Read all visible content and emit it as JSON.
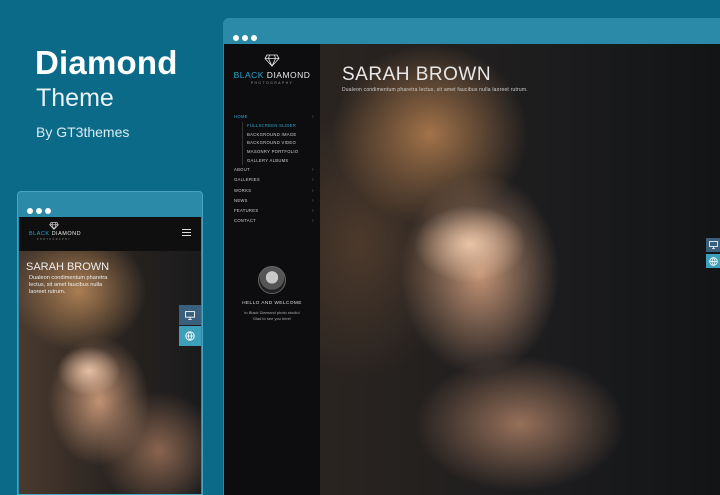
{
  "promo": {
    "title": "Diamond",
    "subtitle": "Theme",
    "byline": "By GT3themes"
  },
  "brand": {
    "logo_black": "BLACK",
    "logo_diamond": " DIAMOND",
    "logo_sub": "PHOTOGRAPHY"
  },
  "sidebar": {
    "menu": [
      {
        "label": "HOME",
        "active": true
      },
      {
        "label": "ABOUT"
      },
      {
        "label": "GALLERIES"
      },
      {
        "label": "WORKS"
      },
      {
        "label": "NEWS"
      },
      {
        "label": "FEATURES"
      },
      {
        "label": "CONTACT"
      }
    ],
    "submenu": [
      {
        "label": "FULLSCREEN SLIDER",
        "active": true
      },
      {
        "label": "BACKGROUND IMAGE"
      },
      {
        "label": "BACKGROUND VIDEO"
      },
      {
        "label": "MASONRY PORTFOLIO"
      },
      {
        "label": "GALLERY ALBUMS"
      }
    ],
    "welcome_title": "HELLO AND WELCOME",
    "welcome_line1": "to Black Diamond photo studio!",
    "welcome_line2": "Glad to see you here!"
  },
  "hero": {
    "title": "SARAH BROWN",
    "caption": "Dualeon condimentum pharetra lectus, sit amet faucibus nulla laoreet rutrum."
  },
  "mobile": {
    "title": "SARAH BROWN",
    "caption": "Dualeon condimentum pharetra lectus, sit amet faucibus nulla laoreet rutrum."
  },
  "colors": {
    "background": "#0b6a88",
    "window_frame": "#2a8aa7",
    "accent": "#2aa7cf"
  },
  "icons": [
    "diamond-icon",
    "monitor-icon",
    "globe-icon",
    "menu-icon",
    "chevron-right-icon"
  ]
}
